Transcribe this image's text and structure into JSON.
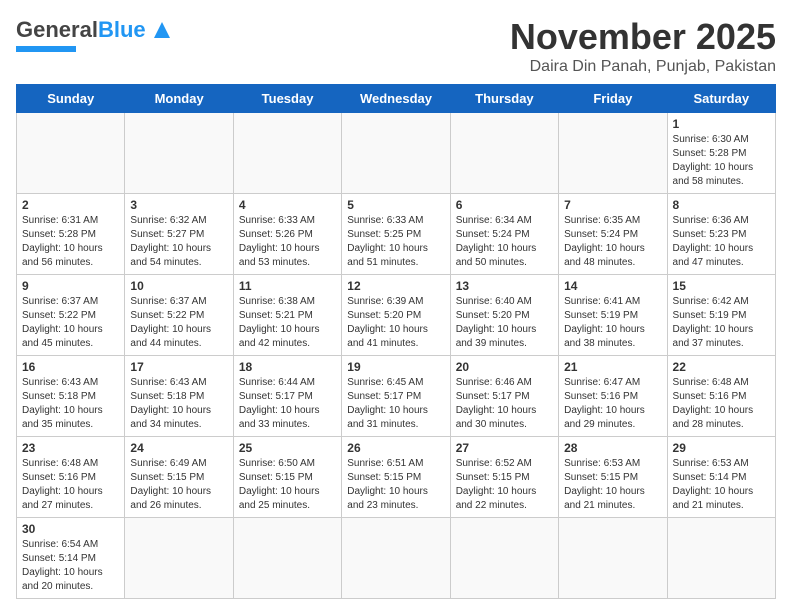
{
  "header": {
    "logo_general": "General",
    "logo_blue": "Blue",
    "month_title": "November 2025",
    "location": "Daira Din Panah, Punjab, Pakistan"
  },
  "weekdays": [
    "Sunday",
    "Monday",
    "Tuesday",
    "Wednesday",
    "Thursday",
    "Friday",
    "Saturday"
  ],
  "weeks": [
    [
      {
        "day": "",
        "text": ""
      },
      {
        "day": "",
        "text": ""
      },
      {
        "day": "",
        "text": ""
      },
      {
        "day": "",
        "text": ""
      },
      {
        "day": "",
        "text": ""
      },
      {
        "day": "",
        "text": ""
      },
      {
        "day": "1",
        "text": "Sunrise: 6:30 AM\nSunset: 5:28 PM\nDaylight: 10 hours and 58 minutes."
      }
    ],
    [
      {
        "day": "2",
        "text": "Sunrise: 6:31 AM\nSunset: 5:28 PM\nDaylight: 10 hours and 56 minutes."
      },
      {
        "day": "3",
        "text": "Sunrise: 6:32 AM\nSunset: 5:27 PM\nDaylight: 10 hours and 54 minutes."
      },
      {
        "day": "4",
        "text": "Sunrise: 6:33 AM\nSunset: 5:26 PM\nDaylight: 10 hours and 53 minutes."
      },
      {
        "day": "5",
        "text": "Sunrise: 6:33 AM\nSunset: 5:25 PM\nDaylight: 10 hours and 51 minutes."
      },
      {
        "day": "6",
        "text": "Sunrise: 6:34 AM\nSunset: 5:24 PM\nDaylight: 10 hours and 50 minutes."
      },
      {
        "day": "7",
        "text": "Sunrise: 6:35 AM\nSunset: 5:24 PM\nDaylight: 10 hours and 48 minutes."
      },
      {
        "day": "8",
        "text": "Sunrise: 6:36 AM\nSunset: 5:23 PM\nDaylight: 10 hours and 47 minutes."
      }
    ],
    [
      {
        "day": "9",
        "text": "Sunrise: 6:37 AM\nSunset: 5:22 PM\nDaylight: 10 hours and 45 minutes."
      },
      {
        "day": "10",
        "text": "Sunrise: 6:37 AM\nSunset: 5:22 PM\nDaylight: 10 hours and 44 minutes."
      },
      {
        "day": "11",
        "text": "Sunrise: 6:38 AM\nSunset: 5:21 PM\nDaylight: 10 hours and 42 minutes."
      },
      {
        "day": "12",
        "text": "Sunrise: 6:39 AM\nSunset: 5:20 PM\nDaylight: 10 hours and 41 minutes."
      },
      {
        "day": "13",
        "text": "Sunrise: 6:40 AM\nSunset: 5:20 PM\nDaylight: 10 hours and 39 minutes."
      },
      {
        "day": "14",
        "text": "Sunrise: 6:41 AM\nSunset: 5:19 PM\nDaylight: 10 hours and 38 minutes."
      },
      {
        "day": "15",
        "text": "Sunrise: 6:42 AM\nSunset: 5:19 PM\nDaylight: 10 hours and 37 minutes."
      }
    ],
    [
      {
        "day": "16",
        "text": "Sunrise: 6:43 AM\nSunset: 5:18 PM\nDaylight: 10 hours and 35 minutes."
      },
      {
        "day": "17",
        "text": "Sunrise: 6:43 AM\nSunset: 5:18 PM\nDaylight: 10 hours and 34 minutes."
      },
      {
        "day": "18",
        "text": "Sunrise: 6:44 AM\nSunset: 5:17 PM\nDaylight: 10 hours and 33 minutes."
      },
      {
        "day": "19",
        "text": "Sunrise: 6:45 AM\nSunset: 5:17 PM\nDaylight: 10 hours and 31 minutes."
      },
      {
        "day": "20",
        "text": "Sunrise: 6:46 AM\nSunset: 5:17 PM\nDaylight: 10 hours and 30 minutes."
      },
      {
        "day": "21",
        "text": "Sunrise: 6:47 AM\nSunset: 5:16 PM\nDaylight: 10 hours and 29 minutes."
      },
      {
        "day": "22",
        "text": "Sunrise: 6:48 AM\nSunset: 5:16 PM\nDaylight: 10 hours and 28 minutes."
      }
    ],
    [
      {
        "day": "23",
        "text": "Sunrise: 6:48 AM\nSunset: 5:16 PM\nDaylight: 10 hours and 27 minutes."
      },
      {
        "day": "24",
        "text": "Sunrise: 6:49 AM\nSunset: 5:15 PM\nDaylight: 10 hours and 26 minutes."
      },
      {
        "day": "25",
        "text": "Sunrise: 6:50 AM\nSunset: 5:15 PM\nDaylight: 10 hours and 25 minutes."
      },
      {
        "day": "26",
        "text": "Sunrise: 6:51 AM\nSunset: 5:15 PM\nDaylight: 10 hours and 23 minutes."
      },
      {
        "day": "27",
        "text": "Sunrise: 6:52 AM\nSunset: 5:15 PM\nDaylight: 10 hours and 22 minutes."
      },
      {
        "day": "28",
        "text": "Sunrise: 6:53 AM\nSunset: 5:15 PM\nDaylight: 10 hours and 21 minutes."
      },
      {
        "day": "29",
        "text": "Sunrise: 6:53 AM\nSunset: 5:14 PM\nDaylight: 10 hours and 21 minutes."
      }
    ],
    [
      {
        "day": "30",
        "text": "Sunrise: 6:54 AM\nSunset: 5:14 PM\nDaylight: 10 hours and 20 minutes."
      },
      {
        "day": "",
        "text": ""
      },
      {
        "day": "",
        "text": ""
      },
      {
        "day": "",
        "text": ""
      },
      {
        "day": "",
        "text": ""
      },
      {
        "day": "",
        "text": ""
      },
      {
        "day": "",
        "text": ""
      }
    ]
  ]
}
